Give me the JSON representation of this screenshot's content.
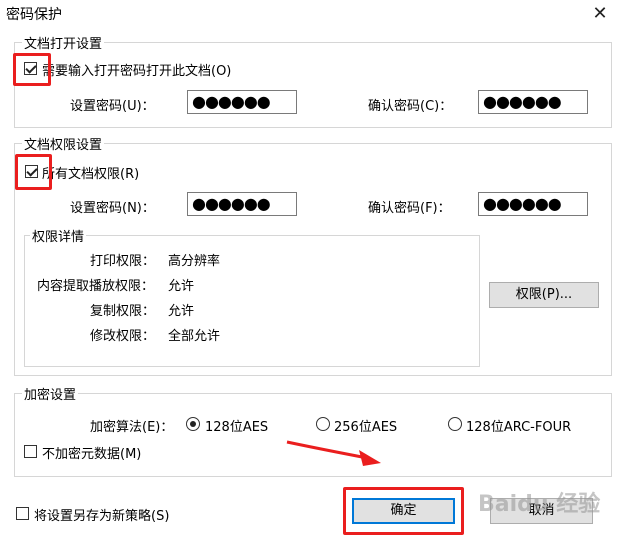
{
  "window": {
    "title": "密码保护",
    "close_glyph": "✕"
  },
  "open_settings": {
    "group_label": "文档打开设置",
    "require_password_label": "需要输入打开密码打开此文档(O)",
    "require_password_checked": true,
    "set_password_label": "设置密码(U)：",
    "set_password_value": "●●●●●●",
    "confirm_password_label": "确认密码(C)：",
    "confirm_password_value": "●●●●●●"
  },
  "permission_settings": {
    "group_label": "文档权限设置",
    "all_permissions_label": "所有文档权限(R)",
    "all_permissions_checked": true,
    "set_password_label": "设置密码(N)：",
    "set_password_value": "●●●●●●",
    "confirm_password_label": "确认密码(F)：",
    "confirm_password_value": "●●●●●●",
    "details": {
      "group_label": "权限详情",
      "rows": [
        {
          "label": "打印权限：",
          "value": "高分辨率"
        },
        {
          "label": "内容提取播放权限：",
          "value": "允许"
        },
        {
          "label": "复制权限：",
          "value": "允许"
        },
        {
          "label": "修改权限：",
          "value": "全部允许"
        }
      ]
    },
    "permissions_button": "权限(P)..."
  },
  "encryption": {
    "group_label": "加密设置",
    "algorithm_label": "加密算法(E)：",
    "options": [
      {
        "label": "128位AES",
        "selected": true
      },
      {
        "label": "256位AES",
        "selected": false
      },
      {
        "label": "128位ARC-FOUR",
        "selected": false
      }
    ],
    "no_metadata_label": "不加密元数据(M)",
    "no_metadata_checked": false
  },
  "footer": {
    "save_as_policy_label": "将设置另存为新策略(S)",
    "save_as_policy_checked": false,
    "ok_button": "确定",
    "cancel_button": "取消"
  },
  "watermark": "Baidu 经验",
  "colors": {
    "highlight": "#ea1e1e",
    "default_button_border": "#0078d7"
  }
}
